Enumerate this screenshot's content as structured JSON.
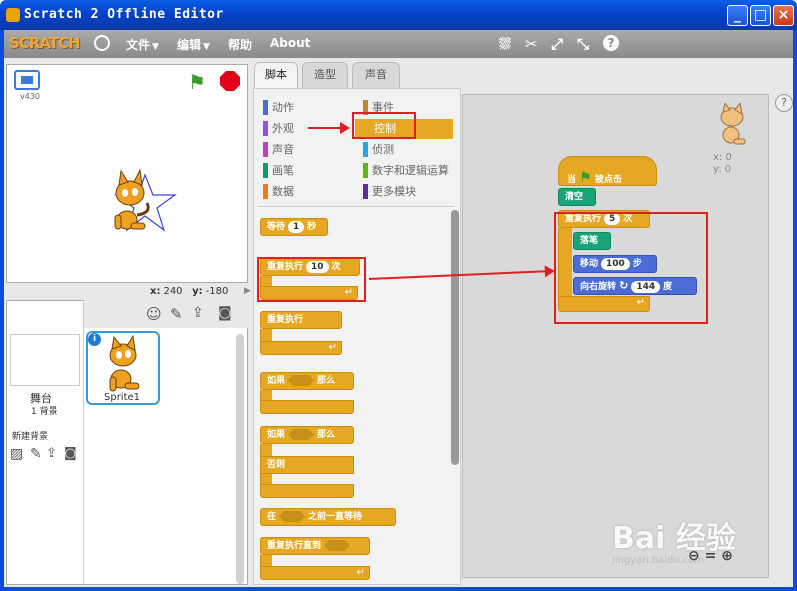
{
  "window": {
    "title": "Scratch 2 Offline Editor",
    "minimize": "_",
    "maximize": "□",
    "close": "×"
  },
  "menu": {
    "logo": "SCRATCH",
    "file": "文件",
    "edit": "编辑",
    "help": "帮助",
    "about": "About"
  },
  "stage": {
    "version": "v430",
    "coords_x_label": "x:",
    "coords_x": "240",
    "coords_y_label": "y:",
    "coords_y": "-180"
  },
  "sprites": {
    "stage_label": "舞台",
    "backdrop_count": "1 背景",
    "new_backdrop": "新建背景",
    "sprite_name": "Sprite1",
    "info": "i"
  },
  "tabs": {
    "scripts": "脚本",
    "costumes": "造型",
    "sounds": "声音"
  },
  "categories": {
    "left": [
      "动作",
      "外观",
      "声音",
      "画笔",
      "数据"
    ],
    "right": [
      "事件",
      "控制",
      "侦测",
      "数字和逻辑运算",
      "更多模块"
    ],
    "colors": {
      "motion": "#4a6cd4",
      "looks": "#8a55d7",
      "sound": "#bb42c3",
      "pen": "#0e9a6c",
      "data": "#ee7d16",
      "events": "#c88330",
      "control": "#e6a822",
      "sensing": "#2ca5e2",
      "operators": "#5cb712",
      "more": "#632d99"
    }
  },
  "palette": {
    "wait": "等待",
    "wait_val": "1",
    "wait_unit": "秒",
    "repeat": "重复执行",
    "repeat_val": "10",
    "repeat_unit": "次",
    "forever": "重复执行",
    "if1": "如果",
    "then1": "那么",
    "if2": "如果",
    "then2": "那么",
    "else": "否则",
    "wait_until_pre": "在",
    "wait_until_post": "之前一直等待",
    "repeat_until": "重复执行直到"
  },
  "script": {
    "hat_when": "当",
    "hat_clicked": "被点击",
    "clear": "清空",
    "repeat": "重复执行",
    "repeat_val": "5",
    "repeat_unit": "次",
    "pen_down": "落笔",
    "move": "移动",
    "move_val": "100",
    "move_unit": "步",
    "turn": "向右旋转",
    "turn_val": "144",
    "turn_unit": "度"
  },
  "sprite_info": {
    "x_label": "x:",
    "x": "0",
    "y_label": "y:",
    "y": "0"
  },
  "help": "?",
  "zoom": {
    "out": "⊖",
    "reset": "=",
    "in": "⊕"
  },
  "watermark": {
    "main": "Bai 经验",
    "sub": "jingyan.baidu.com"
  }
}
